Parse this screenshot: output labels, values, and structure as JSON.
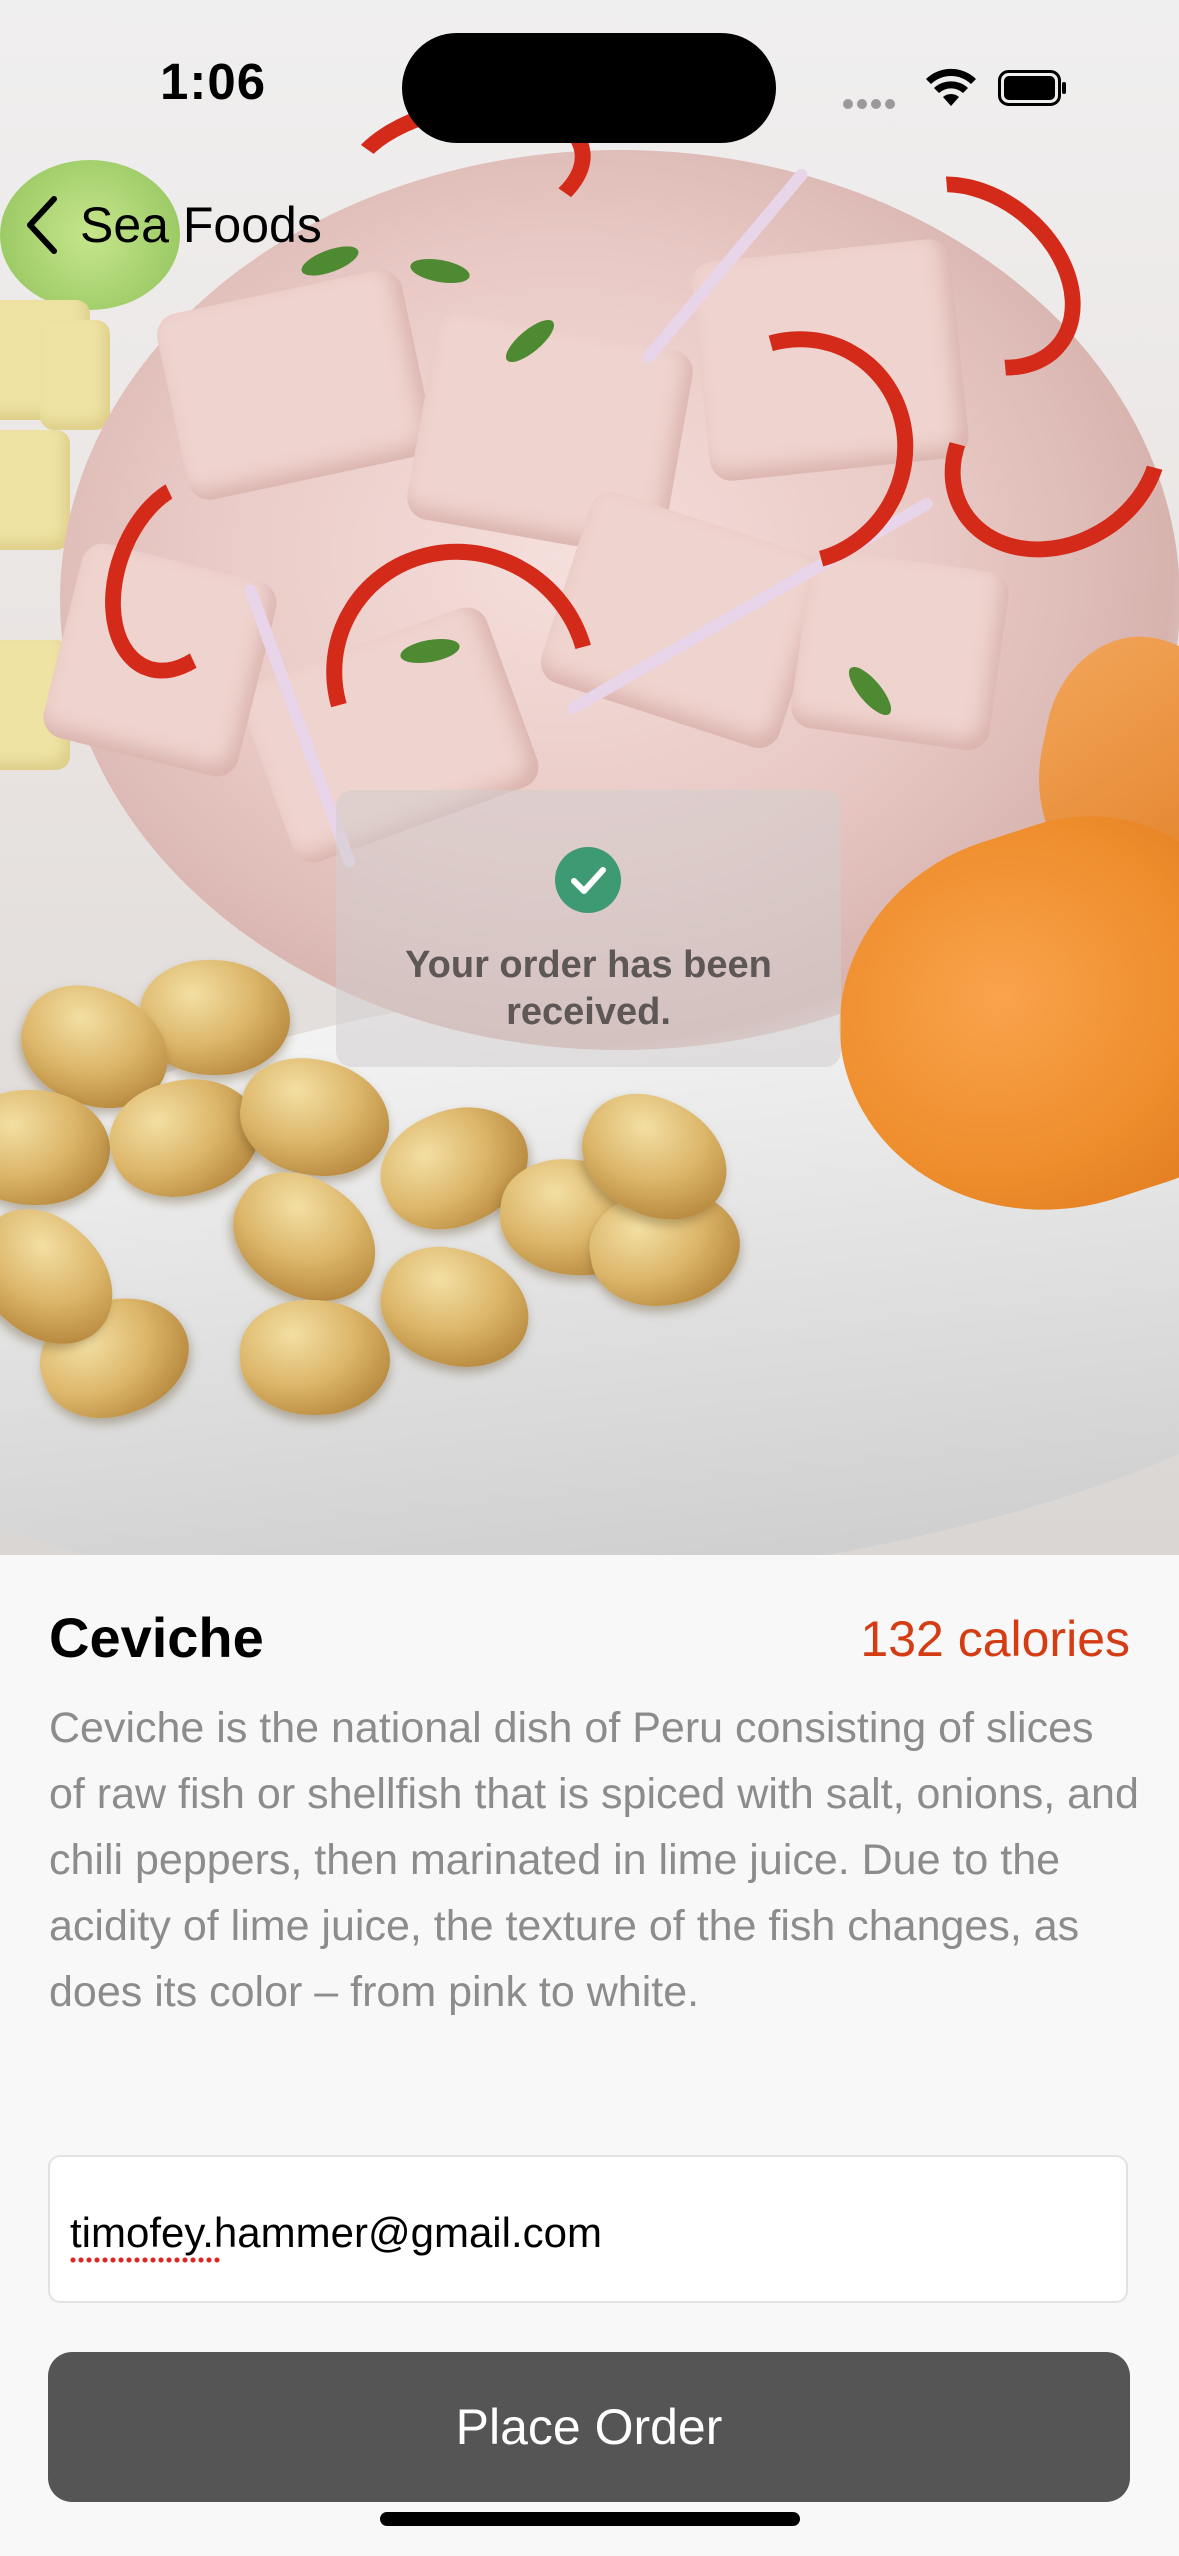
{
  "status_bar": {
    "time": "1:06",
    "icons": [
      "cellular-signal-icon",
      "wifi-icon",
      "battery-icon"
    ]
  },
  "nav": {
    "back_label": "Sea Foods",
    "back_icon": "chevron-left-icon"
  },
  "toast": {
    "icon": "checkmark-circle-icon",
    "icon_color": "#3e9a72",
    "message": "Your order has been received."
  },
  "dish": {
    "name": "Ceviche",
    "calories": "132 calories",
    "description": "Ceviche is the national dish of Peru consisting of slices of raw fish or shellfish that is spiced with salt, onions, and chili peppers, then marinated in lime juice. Due to the acidity of lime juice, the texture of the fish changes, as does its color – from pink to white."
  },
  "order_form": {
    "email_value": "timofey.hammer@gmail.com",
    "place_order_label": "Place Order"
  },
  "colors": {
    "accent": "#d43c14",
    "button_bg": "#555555",
    "description_text": "#8c8c8c"
  }
}
